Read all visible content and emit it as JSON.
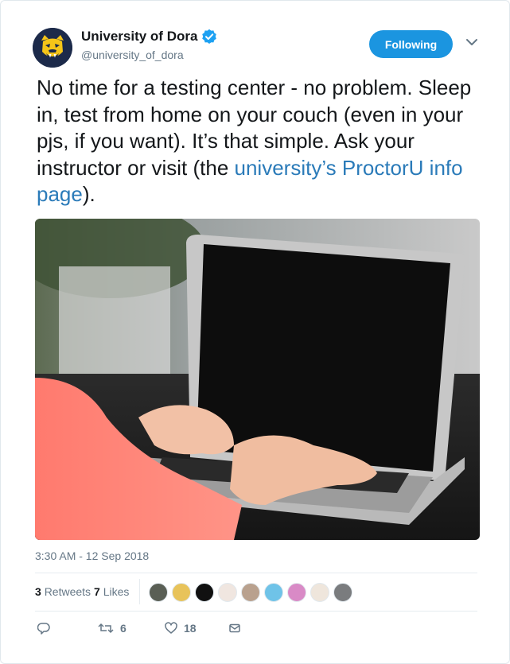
{
  "account": {
    "display_name": "University of Dora",
    "handle": "@university_of_dora",
    "verified": true,
    "avatar_icon": "bulldog-logo-icon"
  },
  "follow_button": {
    "label": "Following",
    "color": "#1b95e0"
  },
  "tweet": {
    "text_before_link": "No time for a testing center - no problem. Sleep in, test from home on your couch (even in your pjs, if you want). It’s that simple. Ask your instructor or visit (the ",
    "link_text": "university’s ProctorU info page",
    "text_after_link": ").",
    "link_color": "#2b7bb9",
    "image": "laptop-typing-photo"
  },
  "timestamp": "3:30 AM - 12 Sep 2018",
  "stats": {
    "retweets_count": "3",
    "retweets_label": "Retweets",
    "likes_count": "7",
    "likes_label": "Likes"
  },
  "likers": [
    {
      "icon": "liker-avatar-1",
      "color": "#5a5f55"
    },
    {
      "icon": "liker-avatar-2",
      "color": "#e8c35a"
    },
    {
      "icon": "liker-avatar-3",
      "color": "#111111"
    },
    {
      "icon": "liker-avatar-4",
      "color": "#f0e6e0"
    },
    {
      "icon": "liker-avatar-5",
      "color": "#b9a18e"
    },
    {
      "icon": "liker-avatar-6",
      "color": "#6fc3e8"
    },
    {
      "icon": "liker-avatar-7",
      "color": "#d98ac6"
    },
    {
      "icon": "liker-avatar-8",
      "color": "#efe6dc"
    },
    {
      "icon": "liker-avatar-9",
      "color": "#7a7c7e"
    }
  ],
  "actions": {
    "reply_icon": "reply-icon",
    "retweet_count": "6",
    "like_count": "18",
    "dm_icon": "direct-message-icon"
  }
}
